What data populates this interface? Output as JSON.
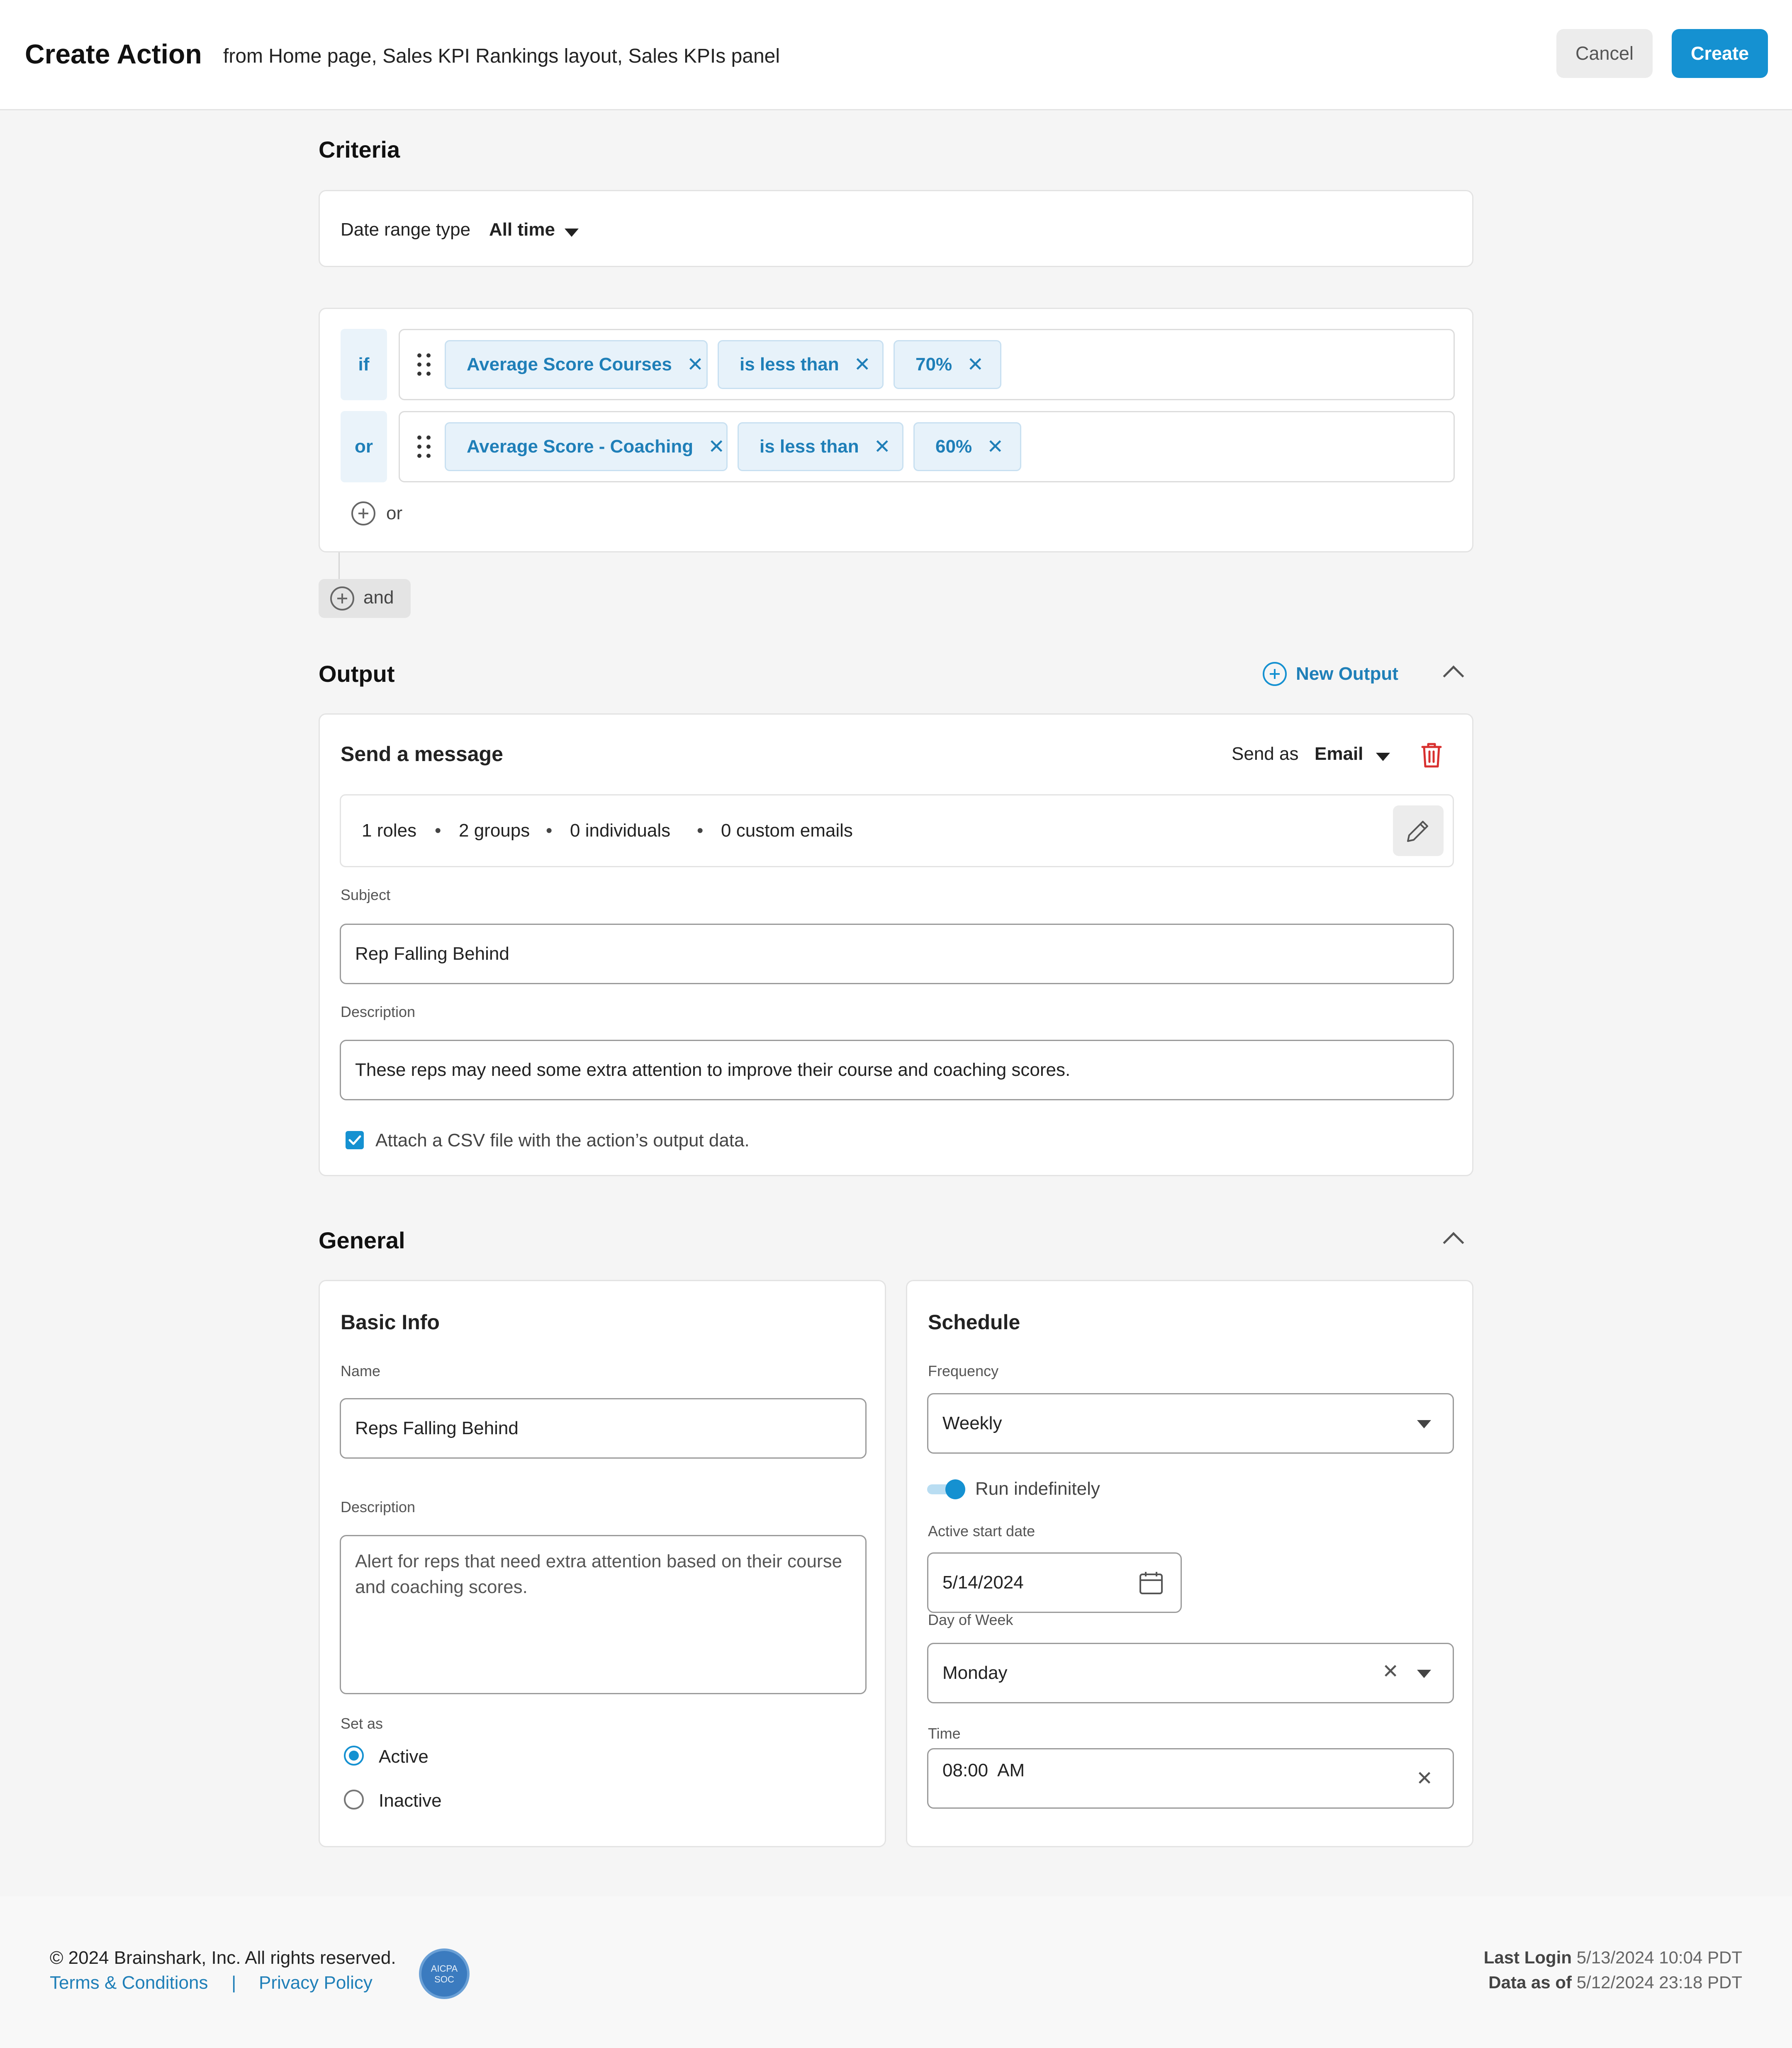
{
  "header": {
    "title": "Create Action",
    "subtitle": "from Home page, Sales KPI Rankings layout, Sales KPIs panel",
    "cancel_label": "Cancel",
    "create_label": "Create"
  },
  "criteria": {
    "title": "Criteria",
    "date_range_label": "Date range type",
    "date_range_value": "All time",
    "conditions": [
      {
        "connector": "if",
        "chips": [
          "Average Score Courses",
          "is less than",
          "70%"
        ]
      },
      {
        "connector": "or",
        "chips": [
          "Average Score - Coaching",
          "is less than",
          "60%"
        ]
      }
    ],
    "add_or_label": "or",
    "add_and_label": "and"
  },
  "output": {
    "title": "Output",
    "new_output_label": "New Output",
    "card_title": "Send a message",
    "send_as_label": "Send as",
    "send_as_value": "Email",
    "recipients": {
      "roles": "1 roles",
      "groups": "2 groups",
      "individuals": "0 individuals",
      "custom": "0 custom emails",
      "separator": "•"
    },
    "subject_label": "Subject",
    "subject_value": "Rep Falling Behind",
    "description_label": "Description",
    "description_value": "These reps may need some extra attention to improve their course and coaching scores.",
    "attach_csv_label": "Attach a CSV file with the action’s output data.",
    "attach_csv_checked": true
  },
  "general": {
    "title": "General",
    "basic_info": {
      "title": "Basic Info",
      "name_label": "Name",
      "name_value": "Reps Falling Behind",
      "description_label": "Description",
      "description_value": "Alert for reps that need extra attention based on their course and coaching scores.",
      "set_as_label": "Set as",
      "options": [
        "Active",
        "Inactive"
      ],
      "selected": "Active"
    },
    "schedule": {
      "title": "Schedule",
      "frequency_label": "Frequency",
      "frequency_value": "Weekly",
      "run_indefinitely_label": "Run indefinitely",
      "run_indefinitely_on": true,
      "start_date_label": "Active start date",
      "start_date_value": "5/14/2024",
      "day_of_week_label": "Day of Week",
      "day_of_week_value": "Monday",
      "time_label": "Time",
      "time_value": "08:00  AM"
    }
  },
  "footer": {
    "copyright": "© 2024 Brainshark, Inc. All rights reserved.",
    "terms": "Terms & Conditions",
    "divider": "|",
    "privacy": "Privacy Policy",
    "badge_text_1": "AICPA",
    "badge_text_2": "SOC",
    "last_login_label": "Last Login",
    "last_login_value": "5/13/2024 10:04 PDT",
    "data_as_of_label": "Data as of",
    "data_as_of_value": "5/12/2024 23:18 PDT"
  },
  "colors": {
    "accent": "#1591d1",
    "chip_bg": "#e7f2fa",
    "chip_text": "#1f7fb8",
    "danger": "#d8302f"
  }
}
